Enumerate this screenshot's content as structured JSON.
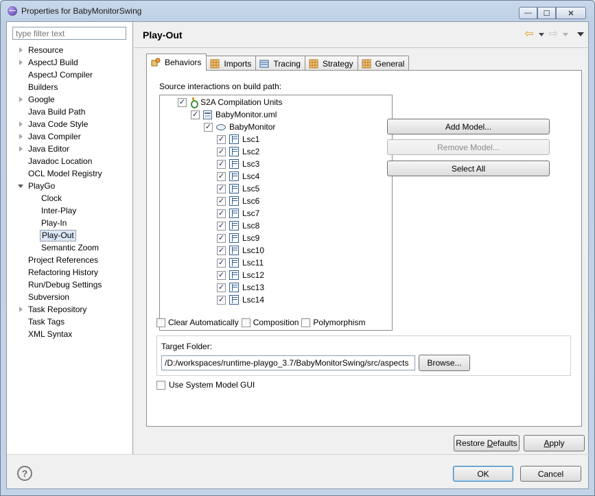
{
  "window": {
    "title": "Properties for BabyMonitorSwing",
    "controls": {
      "minimize": "—",
      "maximize": "☐",
      "close": "✕"
    }
  },
  "sidebar": {
    "filter_placeholder": "type filter text",
    "items": [
      {
        "label": "Resource",
        "expandable": true,
        "expanded": false
      },
      {
        "label": "AspectJ Build",
        "expandable": true,
        "expanded": false
      },
      {
        "label": "AspectJ Compiler",
        "expandable": false
      },
      {
        "label": "Builders",
        "expandable": false
      },
      {
        "label": "Google",
        "expandable": true,
        "expanded": false
      },
      {
        "label": "Java Build Path",
        "expandable": false
      },
      {
        "label": "Java Code Style",
        "expandable": true,
        "expanded": false
      },
      {
        "label": "Java Compiler",
        "expandable": true,
        "expanded": false
      },
      {
        "label": "Java Editor",
        "expandable": true,
        "expanded": false
      },
      {
        "label": "Javadoc Location",
        "expandable": false
      },
      {
        "label": "OCL Model Registry",
        "expandable": false
      },
      {
        "label": "PlayGo",
        "expandable": true,
        "expanded": true
      },
      {
        "label": "Clock",
        "child": true
      },
      {
        "label": "Inter-Play",
        "child": true
      },
      {
        "label": "Play-In",
        "child": true
      },
      {
        "label": "Play-Out",
        "child": true,
        "selected": true
      },
      {
        "label": "Semantic Zoom",
        "child": true
      },
      {
        "label": "Project References",
        "expandable": false
      },
      {
        "label": "Refactoring History",
        "expandable": false
      },
      {
        "label": "Run/Debug Settings",
        "expandable": false
      },
      {
        "label": "Subversion",
        "expandable": false
      },
      {
        "label": "Task Repository",
        "expandable": true,
        "expanded": false
      },
      {
        "label": "Task Tags",
        "expandable": false
      },
      {
        "label": "XML Syntax",
        "expandable": false
      }
    ]
  },
  "page": {
    "title": "Play-Out",
    "tabs": [
      {
        "label": "Behaviors",
        "icon": "behaviors-icon",
        "active": true
      },
      {
        "label": "Imports",
        "icon": "grid-icon"
      },
      {
        "label": "Tracing",
        "icon": "tracing-icon"
      },
      {
        "label": "Strategy",
        "icon": "grid-icon"
      },
      {
        "label": "General",
        "icon": "grid-icon"
      }
    ],
    "source_label": "Source interactions on build path:",
    "tree": {
      "root": {
        "label": "S2A Compilation Units",
        "checked": true
      },
      "model": {
        "label": "BabyMonitor.uml",
        "checked": true
      },
      "collab": {
        "label": "BabyMonitor",
        "checked": true
      },
      "lscs": [
        "Lsc1",
        "Lsc2",
        "Lsc3",
        "Lsc4",
        "Lsc5",
        "Lsc6",
        "Lsc7",
        "Lsc8",
        "Lsc9",
        "Lsc10",
        "Lsc11",
        "Lsc12",
        "Lsc13",
        "Lsc14"
      ]
    },
    "buttons": {
      "add_model": "Add Model...",
      "remove_model": "Remove Model...",
      "select_all": "Select All"
    },
    "options": {
      "clear_auto": "Clear Automatically",
      "composition": "Composition",
      "polymorphism": "Polymorphism"
    },
    "target": {
      "label": "Target Folder:",
      "value": "/D:/workspaces/runtime-playgo_3.7/BabyMonitorSwing/src/aspects",
      "browse": "Browse..."
    },
    "use_gui": "Use System Model GUI"
  },
  "footer": {
    "restore_pre": "Restore ",
    "restore_mn": "D",
    "restore_post": "efaults",
    "apply_mn": "A",
    "apply_post": "pply",
    "ok": "OK",
    "cancel": "Cancel",
    "help": "?"
  },
  "colors": {
    "selection": "#dbe8f8",
    "nav_arrow": "#e8a11f",
    "default_button_border": "#3c7fb1"
  }
}
